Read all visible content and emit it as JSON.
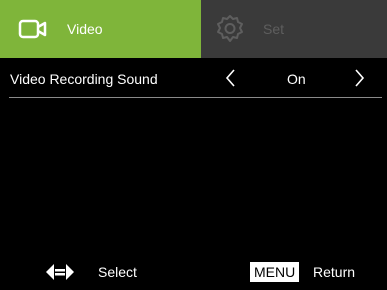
{
  "tabs": {
    "video": {
      "label": "Video",
      "icon": "video-camera-icon",
      "active": true,
      "color": "#7fb53a"
    },
    "set": {
      "label": "Set",
      "icon": "gear-icon",
      "active": false,
      "color": "#3a3a3a"
    }
  },
  "settings": [
    {
      "label": "Video Recording Sound",
      "value": "On"
    }
  ],
  "footer": {
    "select_icon": "dpad-left-right-icon",
    "select_label": "Select",
    "menu_key": "MENU",
    "return_label": "Return"
  }
}
